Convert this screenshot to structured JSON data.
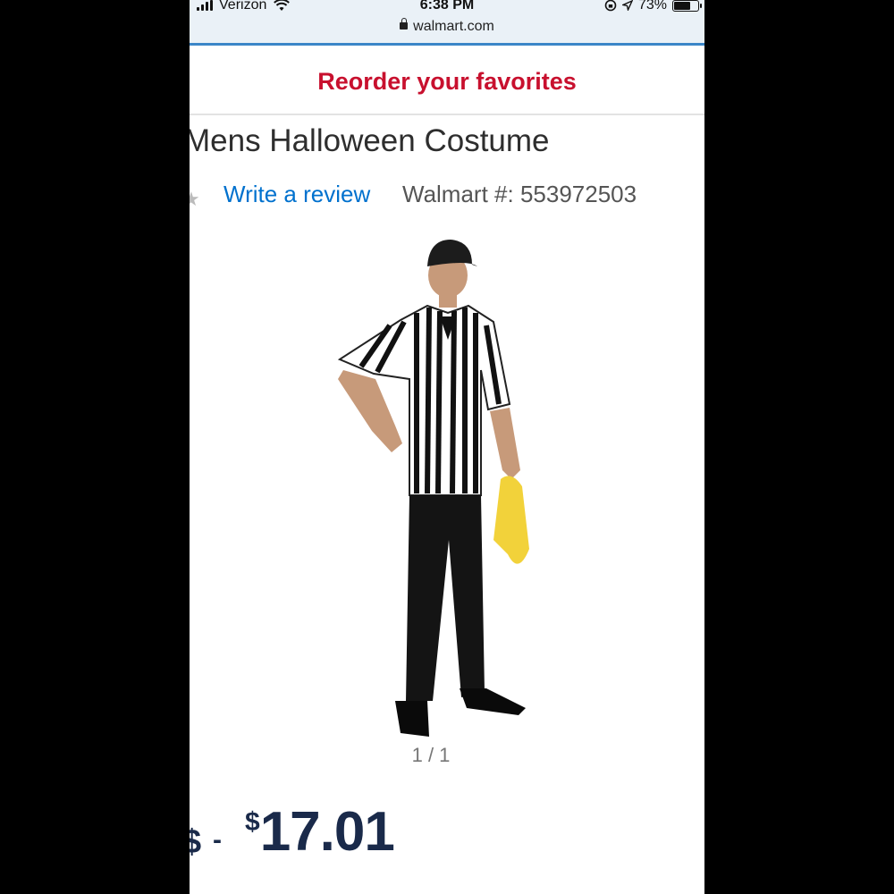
{
  "status_bar": {
    "carrier": "Verizon",
    "time": "6:38 PM",
    "battery_percent": "73%",
    "battery_level": 0.73,
    "url": "walmart.com"
  },
  "banner": {
    "reorder": "Reorder your favorites"
  },
  "product": {
    "title": "Mens Halloween Costume",
    "review_link": "Write a review",
    "walmart_number": "Walmart #: 553972503",
    "image_icon": "referee-costume-photo",
    "pager": "1 / 1",
    "price_fragment": "$",
    "price_dash": "-",
    "price_currency": "$",
    "price_amount": "17.01"
  },
  "colors": {
    "accent_red": "#c8102e",
    "link_blue": "#0071ce",
    "price_navy": "#1a2a4a"
  }
}
